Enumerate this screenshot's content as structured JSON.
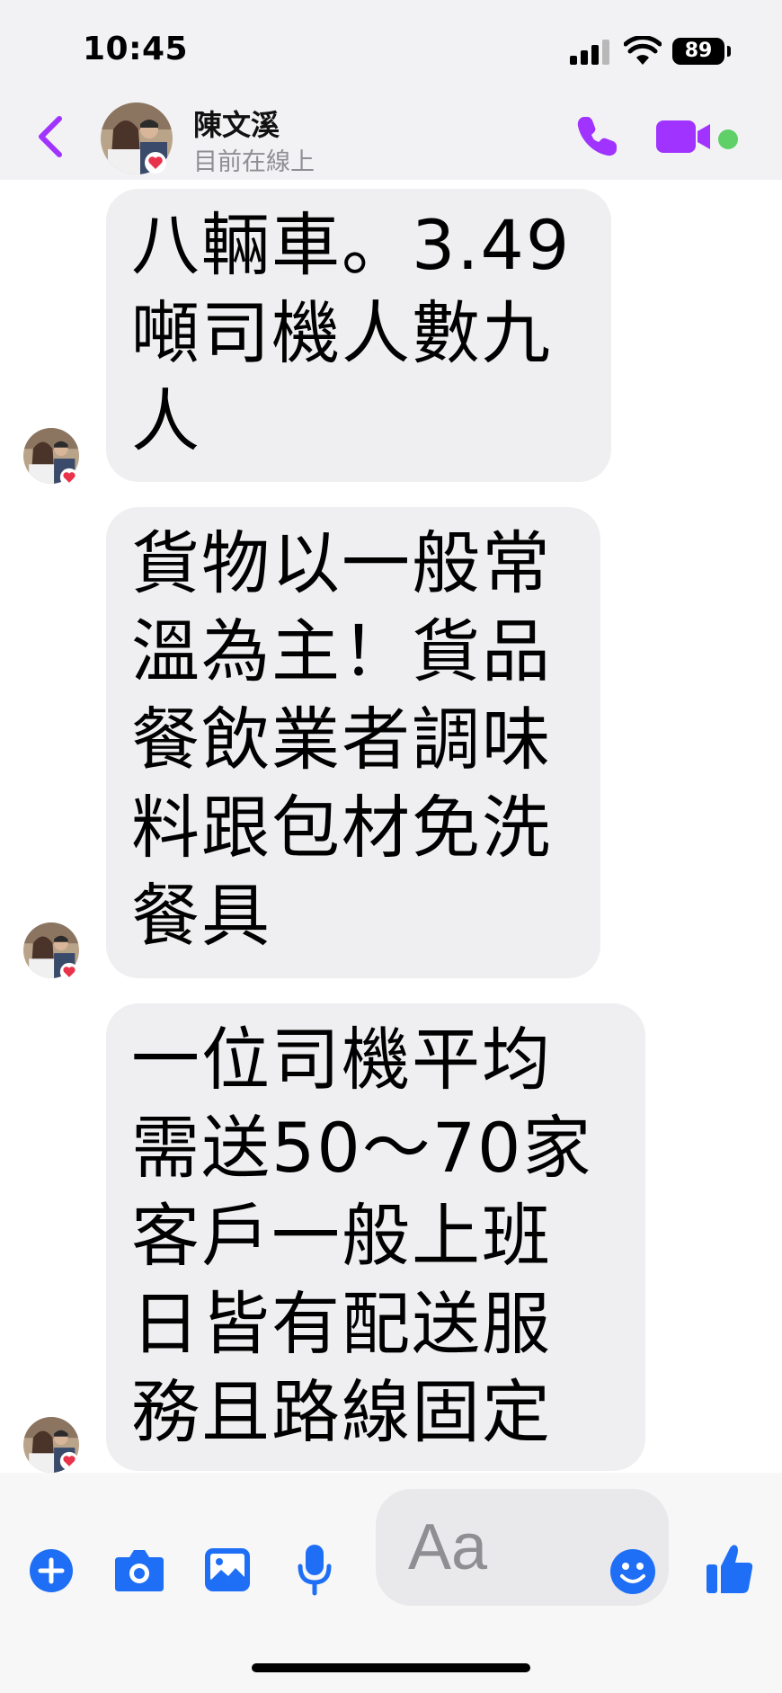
{
  "status_bar": {
    "time": "10:45",
    "battery": "89"
  },
  "header": {
    "contact_name": "陳文溪",
    "contact_status": "目前在線上",
    "accent_color": "#a033ff",
    "online_color": "#5fd068"
  },
  "messages": [
    {
      "text": "八輛車。3.49噸司機人數九人"
    },
    {
      "text": "貨物以一般常溫為主！貨品餐飲業者調味料跟包材免洗餐具"
    },
    {
      "text": "一位司機平均需送50～70家客戶一般上班日皆有配送服務且路線固定"
    }
  ],
  "composer": {
    "placeholder": "Aa",
    "icons": [
      "plus-icon",
      "camera-icon",
      "image-icon",
      "microphone-icon",
      "emoji-icon",
      "thumbs-up-icon"
    ],
    "tool_color": "#1e6ff5"
  }
}
